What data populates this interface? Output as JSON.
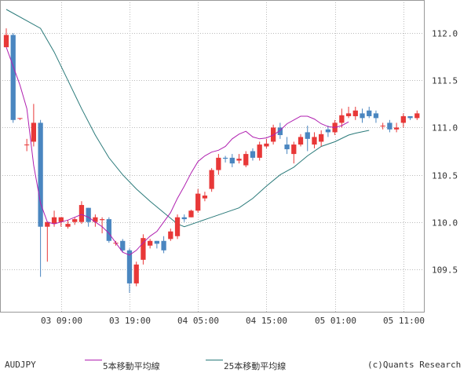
{
  "chart_data": {
    "type": "candlestick",
    "symbol": "AUDJPY",
    "credit": "(c)Quants Research",
    "ylim": [
      109.05,
      112.35
    ],
    "y_ticks": [
      "112.0",
      "111.5",
      "111.0",
      "110.5",
      "110.0",
      "109.5"
    ],
    "x_ticks": [
      "03 09:00",
      "03 19:00",
      "04 05:00",
      "04 15:00",
      "05 01:00",
      "05 11:00"
    ],
    "grid": true,
    "colors": {
      "up": "#e83838",
      "down": "#4a86c0",
      "ma5": "#b020b0",
      "ma25": "#2a7a7a",
      "grid": "#bbbbbb"
    },
    "series": [
      {
        "name": "5本移動平均線",
        "color": "#b020b0",
        "values": [
          111.85,
          111.65,
          111.45,
          111.2,
          110.6,
          110.2,
          110.0,
          109.98,
          110.0,
          110.02,
          110.05,
          110.08,
          110.05,
          110.0,
          109.95,
          109.88,
          109.78,
          109.68,
          109.65,
          109.7,
          109.78,
          109.85,
          109.9,
          110.0,
          110.1,
          110.25,
          110.38,
          110.52,
          110.64,
          110.7,
          110.74,
          110.76,
          110.8,
          110.88,
          110.93,
          110.96,
          110.9,
          110.88,
          110.89,
          110.92,
          110.97,
          111.04,
          111.08,
          111.12,
          111.12,
          111.09,
          111.04,
          111.01,
          111.0,
          111.02,
          111.06
        ]
      },
      {
        "name": "25本移動平均線",
        "color": "#2a7a7a",
        "points": [
          [
            0,
            112.25
          ],
          [
            5,
            112.05
          ],
          [
            7,
            111.8
          ],
          [
            9,
            111.5
          ],
          [
            11,
            111.2
          ],
          [
            13,
            110.92
          ],
          [
            15,
            110.68
          ],
          [
            17,
            110.5
          ],
          [
            19,
            110.35
          ],
          [
            21,
            110.22
          ],
          [
            23,
            110.1
          ],
          [
            25,
            109.98
          ],
          [
            26,
            109.95
          ],
          [
            28,
            110.0
          ],
          [
            30,
            110.05
          ],
          [
            32,
            110.1
          ],
          [
            34,
            110.15
          ],
          [
            36,
            110.25
          ],
          [
            38,
            110.38
          ],
          [
            40,
            110.5
          ],
          [
            42,
            110.58
          ],
          [
            44,
            110.7
          ],
          [
            46,
            110.8
          ],
          [
            48,
            110.85
          ],
          [
            50,
            110.92
          ],
          [
            51,
            110.94
          ],
          [
            53,
            110.97
          ]
        ]
      }
    ],
    "candles": [
      [
        111.85,
        111.98,
        111.92,
        112.05
      ],
      [
        111.98,
        111.08,
        111.05,
        112.0
      ],
      [
        111.1,
        111.1,
        111.08,
        111.1
      ],
      [
        110.82,
        110.82,
        110.75,
        110.88
      ],
      [
        110.85,
        111.05,
        110.8,
        111.25
      ],
      [
        111.05,
        109.95,
        109.42,
        111.08
      ],
      [
        109.95,
        110.0,
        109.58,
        110.0
      ],
      [
        109.98,
        110.05,
        109.95,
        110.12
      ],
      [
        110.0,
        110.05,
        109.95,
        110.05
      ],
      [
        109.95,
        109.98,
        109.93,
        110.02
      ],
      [
        110.0,
        110.03,
        109.97,
        110.05
      ],
      [
        110.0,
        110.18,
        109.98,
        110.22
      ],
      [
        110.15,
        110.0,
        109.95,
        110.15
      ],
      [
        110.0,
        110.05,
        109.95,
        110.08
      ],
      [
        110.02,
        110.03,
        109.88,
        110.05
      ],
      [
        110.03,
        109.8,
        109.78,
        110.05
      ],
      [
        109.78,
        109.78,
        109.75,
        109.8
      ],
      [
        109.8,
        109.7,
        109.68,
        109.82
      ],
      [
        109.7,
        109.35,
        109.25,
        109.72
      ],
      [
        109.35,
        109.55,
        109.32,
        109.58
      ],
      [
        109.6,
        109.83,
        109.55,
        109.87
      ],
      [
        109.75,
        109.8,
        109.72,
        109.82
      ],
      [
        109.8,
        109.77,
        109.72,
        109.8
      ],
      [
        109.8,
        109.7,
        109.67,
        109.85
      ],
      [
        109.82,
        109.9,
        109.8,
        109.93
      ],
      [
        109.85,
        110.05,
        109.82,
        110.08
      ],
      [
        110.05,
        110.03,
        110.0,
        110.08
      ],
      [
        110.05,
        110.12,
        110.05,
        110.13
      ],
      [
        110.12,
        110.3,
        110.1,
        110.35
      ],
      [
        110.25,
        110.28,
        110.22,
        110.32
      ],
      [
        110.35,
        110.55,
        110.32,
        110.57
      ],
      [
        110.55,
        110.68,
        110.5,
        110.72
      ],
      [
        110.68,
        110.67,
        110.63,
        110.7
      ],
      [
        110.68,
        110.62,
        110.58,
        110.72
      ],
      [
        110.65,
        110.67,
        110.62,
        110.72
      ],
      [
        110.6,
        110.72,
        110.58,
        110.75
      ],
      [
        110.75,
        110.68,
        110.65,
        110.78
      ],
      [
        110.68,
        110.82,
        110.65,
        110.85
      ],
      [
        110.8,
        110.83,
        110.78,
        110.88
      ],
      [
        110.85,
        111.0,
        110.82,
        111.03
      ],
      [
        111.0,
        110.92,
        110.88,
        111.05
      ],
      [
        110.82,
        110.77,
        110.72,
        110.9
      ],
      [
        110.72,
        110.82,
        110.62,
        110.85
      ],
      [
        110.82,
        110.9,
        110.8,
        110.93
      ],
      [
        110.95,
        110.88,
        110.75,
        111.02
      ],
      [
        110.82,
        110.9,
        110.78,
        110.95
      ],
      [
        110.85,
        110.93,
        110.8,
        110.97
      ],
      [
        110.98,
        110.95,
        110.9,
        111.02
      ],
      [
        110.95,
        111.05,
        110.92,
        111.08
      ],
      [
        111.05,
        111.13,
        111.0,
        111.2
      ],
      [
        111.12,
        111.15,
        111.1,
        111.22
      ],
      [
        111.12,
        111.18,
        111.08,
        111.22
      ],
      [
        111.15,
        111.1,
        111.05,
        111.2
      ],
      [
        111.18,
        111.12,
        111.1,
        111.22
      ],
      [
        111.15,
        111.1,
        111.05,
        111.18
      ],
      [
        111.02,
        111.02,
        110.98,
        111.05
      ],
      [
        111.05,
        110.98,
        110.95,
        111.08
      ],
      [
        110.98,
        111.0,
        110.95,
        111.05
      ],
      [
        111.05,
        111.12,
        111.0,
        111.15
      ],
      [
        111.12,
        111.1,
        111.08,
        111.12
      ],
      [
        111.1,
        111.15,
        111.08,
        111.18
      ]
    ]
  },
  "legend": {
    "symbol": "AUDJPY",
    "ma5_label": "5本移動平均線",
    "ma25_label": "25本移動平均線",
    "credit": "(c)Quants Research"
  }
}
